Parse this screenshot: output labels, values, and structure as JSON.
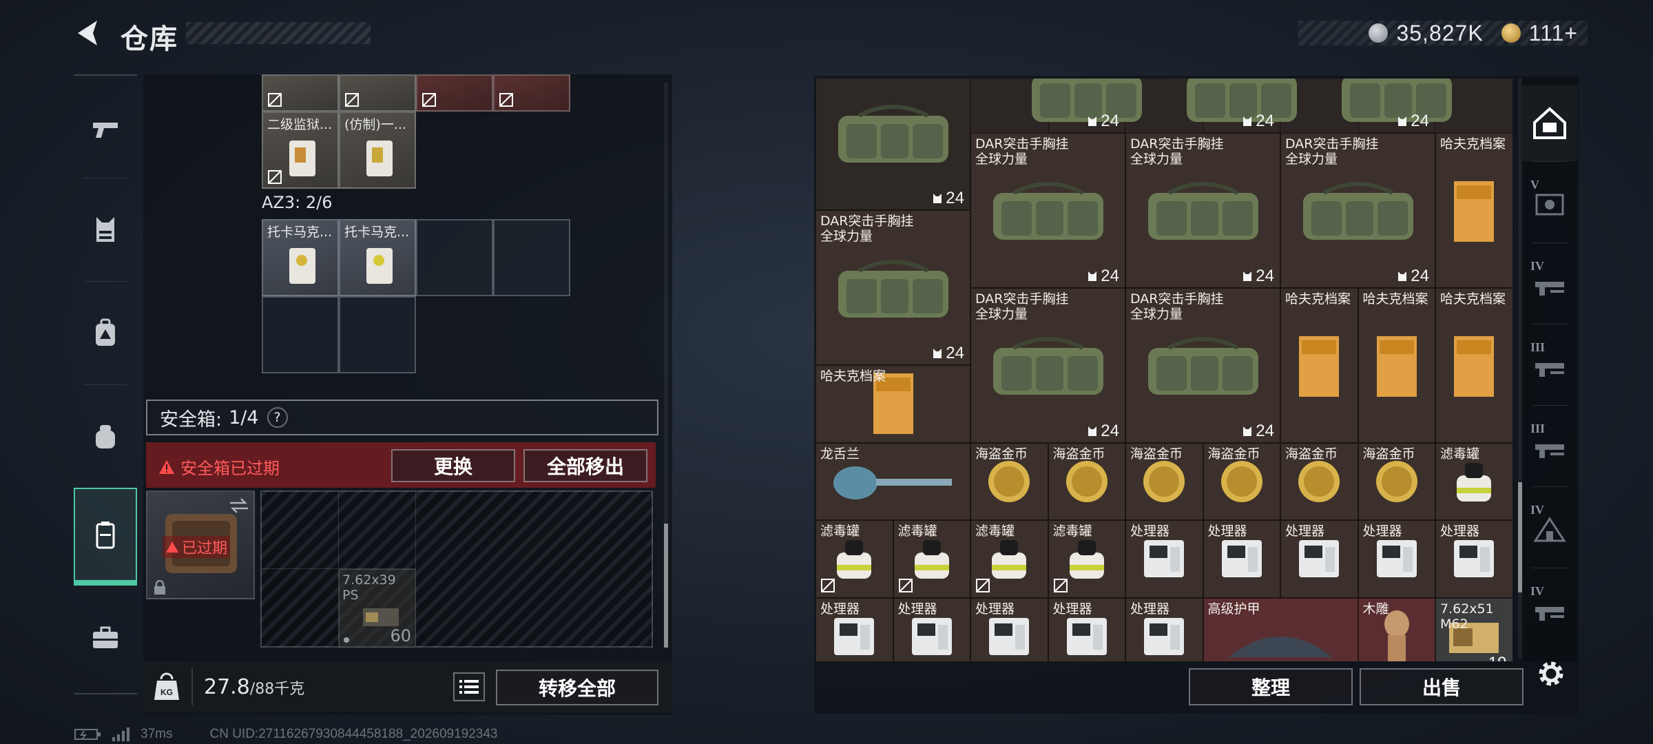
{
  "header": {
    "title": "仓库",
    "currency": [
      {
        "icon": "silver-coin-icon",
        "value": "35,827K",
        "color": "#9aa1a8"
      },
      {
        "icon": "gold-coin-icon",
        "value": "111+",
        "color": "#c79a3a"
      }
    ]
  },
  "left_nav": {
    "items": [
      {
        "icon": "pistol-icon",
        "active": false
      },
      {
        "icon": "chest-rig-icon",
        "active": false
      },
      {
        "icon": "backpack-icon",
        "active": false
      },
      {
        "icon": "pouch-icon",
        "active": false
      },
      {
        "icon": "safe-case-icon",
        "active": true
      },
      {
        "icon": "briefcase-icon",
        "active": false
      }
    ]
  },
  "left_panel": {
    "top_slots": [
      {
        "label": "",
        "style": "filled",
        "locked": true
      },
      {
        "label": "",
        "style": "filled",
        "locked": true
      },
      {
        "label": "",
        "style": "red",
        "locked": true
      },
      {
        "label": "",
        "style": "gold",
        "locked": true
      }
    ],
    "second_row": [
      {
        "label": "二级监狱...",
        "locked": true
      },
      {
        "label": "(仿制)一...",
        "locked": false
      }
    ],
    "az3_label": "AZ3: 2/6",
    "az3_slots": [
      {
        "label": "托卡马克..."
      },
      {
        "label": "托卡马克..."
      }
    ],
    "safe_box": {
      "label": "安全箱:",
      "count": "1/4",
      "help": "?",
      "expired_notice": "安全箱已过期",
      "replace_button": "更换",
      "move_all_out_button": "全部移出",
      "tile_status": "已过期",
      "ammo_label_line1": "7.62x39",
      "ammo_label_line2": "PS",
      "ammo_count": "60"
    },
    "weight": {
      "current": "27.8",
      "max": "/88千克"
    },
    "transfer_all_button": "转移全部"
  },
  "inventory": {
    "cells": [
      {
        "label": "",
        "count": "24",
        "kind": "bag",
        "style": "dark"
      },
      {
        "label": "",
        "count": "24",
        "kind": "bag",
        "style": "dark"
      },
      {
        "label": "",
        "count": "24",
        "kind": "bag",
        "style": "dark"
      },
      {
        "label": "",
        "count": "24",
        "kind": "bag",
        "style": "dark"
      },
      {
        "label": "DAR突击手胸挂\n全球力量",
        "count": "24",
        "kind": "bag"
      },
      {
        "label": "DAR突击手胸挂\n全球力量",
        "count": "24",
        "kind": "bag"
      },
      {
        "label": "DAR突击手胸挂\n全球力量",
        "count": "24",
        "kind": "bag"
      },
      {
        "label": "哈夫克档案",
        "count": "",
        "kind": "file"
      },
      {
        "label": "DAR突击手胸挂\n全球力量",
        "count": "24",
        "kind": "bag"
      },
      {
        "label": "DAR突击手胸挂\n全球力量",
        "count": "24",
        "kind": "bag"
      },
      {
        "label": "DAR突击手胸挂\n全球力量",
        "count": "24",
        "kind": "bag"
      },
      {
        "label": "哈夫克档案",
        "count": "",
        "kind": "file"
      },
      {
        "label": "哈夫克档案",
        "count": "",
        "kind": "file"
      },
      {
        "label": "哈夫克档案",
        "count": "",
        "kind": "file"
      },
      {
        "label": "哈夫克档案",
        "count": "",
        "kind": "file"
      },
      {
        "label": "龙舌兰",
        "count": "",
        "kind": "bottle"
      },
      {
        "label": "海盗金币",
        "count": "",
        "kind": "coin"
      },
      {
        "label": "海盗金币",
        "count": "",
        "kind": "coin"
      },
      {
        "label": "海盗金币",
        "count": "",
        "kind": "coin"
      },
      {
        "label": "海盗金币",
        "count": "",
        "kind": "coin"
      },
      {
        "label": "海盗金币",
        "count": "",
        "kind": "coin"
      },
      {
        "label": "海盗金币",
        "count": "",
        "kind": "coin"
      },
      {
        "label": "滤毒罐",
        "count": "",
        "kind": "canister"
      },
      {
        "label": "滤毒罐",
        "count": "",
        "kind": "canister",
        "locked": true
      },
      {
        "label": "滤毒罐",
        "count": "",
        "kind": "canister",
        "locked": true
      },
      {
        "label": "滤毒罐",
        "count": "",
        "kind": "canister",
        "locked": true
      },
      {
        "label": "滤毒罐",
        "count": "",
        "kind": "canister",
        "locked": true
      },
      {
        "label": "处理器",
        "count": "",
        "kind": "cpu"
      },
      {
        "label": "处理器",
        "count": "",
        "kind": "cpu"
      },
      {
        "label": "处理器",
        "count": "",
        "kind": "cpu"
      },
      {
        "label": "处理器",
        "count": "",
        "kind": "cpu"
      },
      {
        "label": "处理器",
        "count": "",
        "kind": "cpu"
      },
      {
        "label": "处理器",
        "count": "",
        "kind": "cpu"
      },
      {
        "label": "处理器",
        "count": "",
        "kind": "cpu"
      },
      {
        "label": "处理器",
        "count": "",
        "kind": "cpu"
      },
      {
        "label": "处理器",
        "count": "",
        "kind": "cpu"
      },
      {
        "label": "处理器",
        "count": "",
        "kind": "cpu"
      },
      {
        "label": "高级护甲",
        "count": "",
        "kind": "armor",
        "style": "red"
      },
      {
        "label": "木雕",
        "count": "",
        "kind": "statue",
        "style": "red"
      },
      {
        "label": "7.62x51\nM62",
        "count": "19",
        "kind": "ammo",
        "style": "grey"
      }
    ]
  },
  "right_tabs": [
    {
      "icon": "home-stash-icon",
      "tier": ""
    },
    {
      "icon": "gear-case-icon",
      "tier": "V"
    },
    {
      "icon": "rifle-rack-icon",
      "tier": "IV"
    },
    {
      "icon": "rifle-rack-icon",
      "tier": "III"
    },
    {
      "icon": "rifle-rack-icon",
      "tier": "III"
    },
    {
      "icon": "tent-icon",
      "tier": "IV"
    },
    {
      "icon": "rifle-rack-icon",
      "tier": "IV"
    }
  ],
  "bottom_buttons": {
    "organize": "整理",
    "sell": "出售"
  },
  "status": {
    "ping": "37ms",
    "uid": "CN UID:27116267930844458188_202609192343"
  }
}
